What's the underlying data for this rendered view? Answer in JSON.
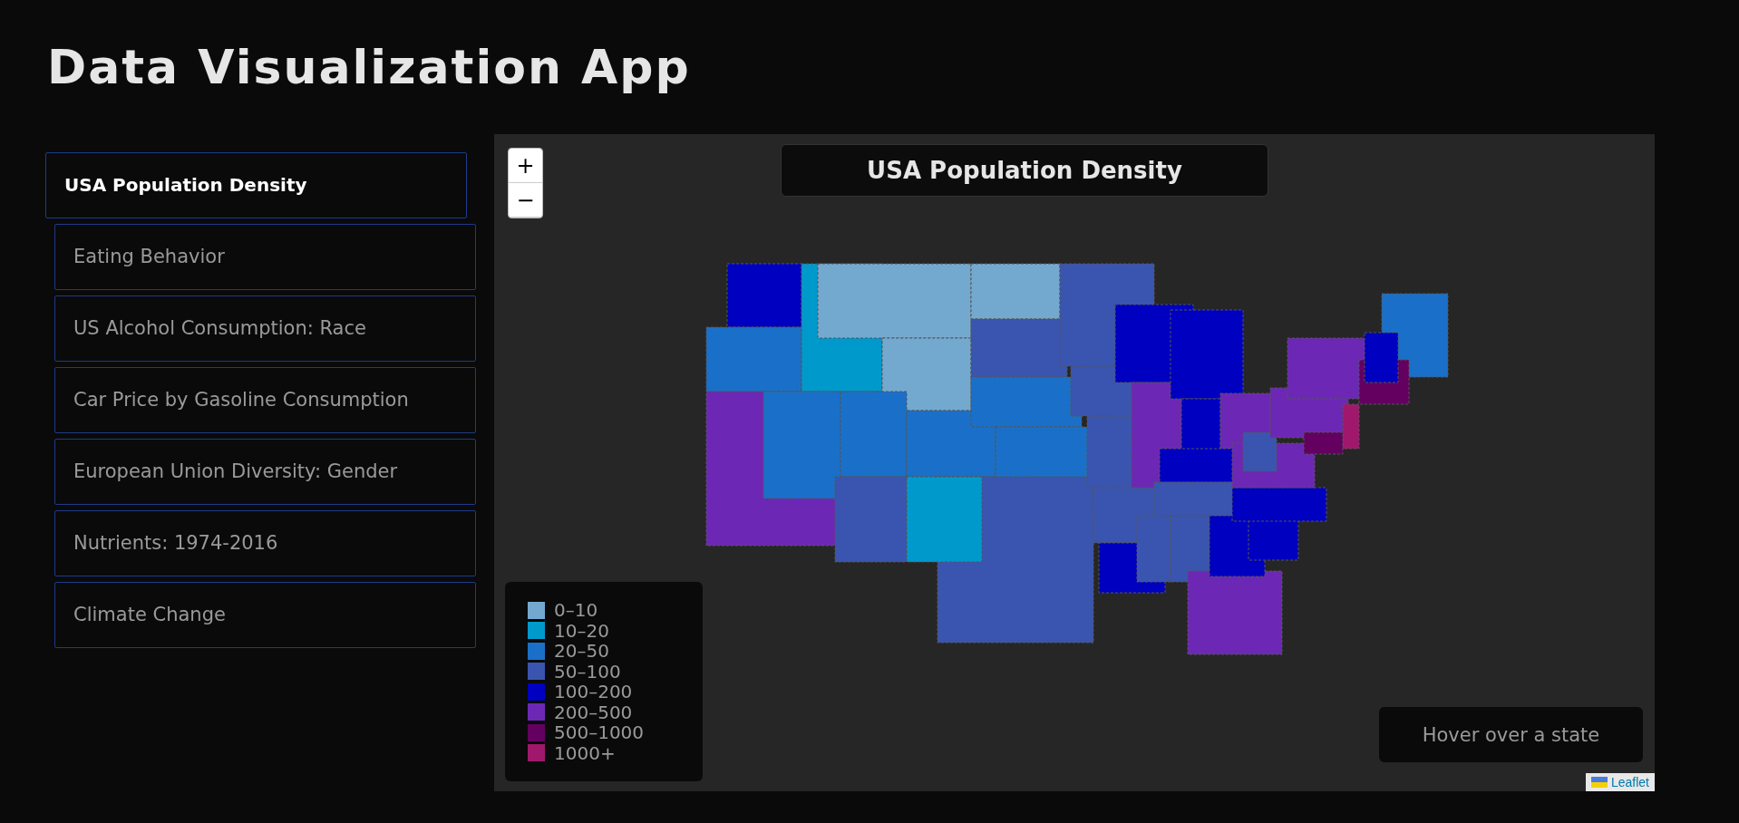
{
  "title": "Data Visualization App",
  "sidebar": {
    "items": [
      {
        "label": "USA Population Density",
        "selected": true
      },
      {
        "label": "Eating Behavior",
        "selected": false
      },
      {
        "label": "US Alcohol Consumption: Race",
        "selected": false
      },
      {
        "label": "Car Price by Gasoline Consumption",
        "selected": false
      },
      {
        "label": "European Union Diversity: Gender",
        "selected": false
      },
      {
        "label": "Nutrients: 1974-2016",
        "selected": false
      },
      {
        "label": "Climate Change",
        "selected": false
      }
    ]
  },
  "map": {
    "zoom_buttons": [
      "+",
      "−"
    ],
    "title": "USA Population Density",
    "legend": [
      {
        "label": "0–10",
        "color": "#74a9cf"
      },
      {
        "label": "10–20",
        "color": "#0099cc"
      },
      {
        "label": "20–50",
        "color": "#1a70c8"
      },
      {
        "label": "50–100",
        "color": "#3a55b0"
      },
      {
        "label": "100–200",
        "color": "#0000c0"
      },
      {
        "label": "200–500",
        "color": "#6c28b4"
      },
      {
        "label": "500–1000",
        "color": "#640060"
      },
      {
        "label": "1000+",
        "color": "#a0186c"
      }
    ],
    "info": "Hover over a state",
    "attribution": "Leaflet"
  }
}
